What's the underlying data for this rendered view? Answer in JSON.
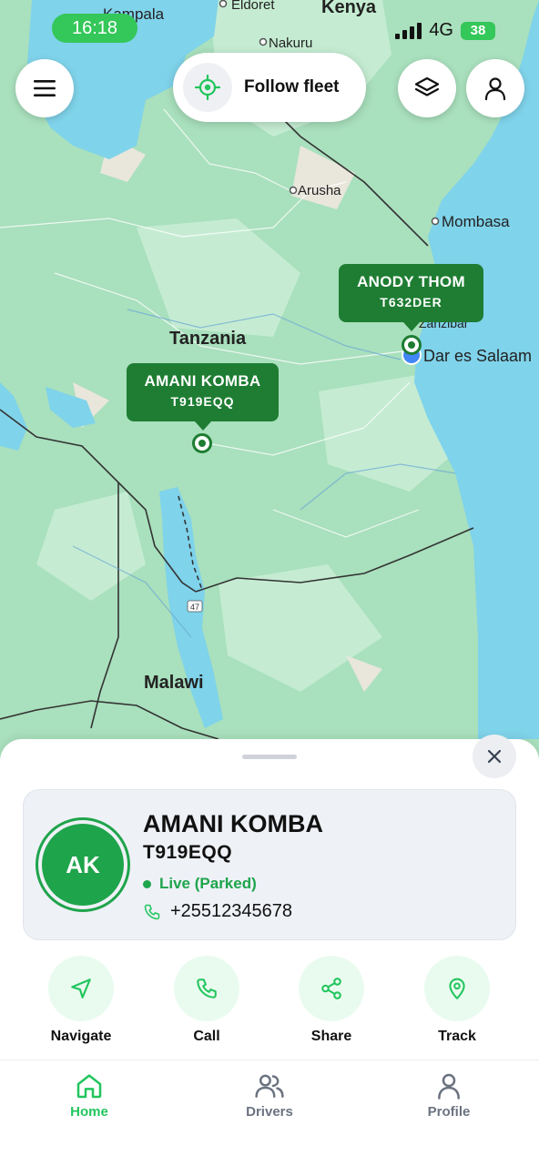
{
  "status_bar": {
    "time": "16:18",
    "network": "4G",
    "battery": "38"
  },
  "map": {
    "labels": {
      "kampala": "Kampala",
      "eldoret": "Eldoret",
      "kenya": "Kenya",
      "nakuru": "Nakuru",
      "arusha": "Arusha",
      "mombasa": "Mombasa",
      "zanzibar": "Zanzibar",
      "dar_es_salaam": "Dar es Salaam",
      "tanzania": "Tanzania",
      "malawi": "Malawi",
      "route": "47"
    },
    "markers": [
      {
        "name": "ANODY THOM",
        "plate": "T632DER"
      },
      {
        "name": "AMANI KOMBA",
        "plate": "T919EQQ"
      }
    ]
  },
  "toolbar": {
    "follow_label": "Follow fleet"
  },
  "driver": {
    "initials": "AK",
    "name": "AMANI KOMBA",
    "plate": "T919EQQ",
    "status": "Live (Parked)",
    "phone": "+25512345678"
  },
  "actions": [
    {
      "label": "Navigate",
      "icon": "navigate-arrow-icon"
    },
    {
      "label": "Call",
      "icon": "phone-icon"
    },
    {
      "label": "Share",
      "icon": "share-icon"
    },
    {
      "label": "Track",
      "icon": "location-pin-icon"
    }
  ],
  "tabs": [
    {
      "label": "Home",
      "icon": "home-icon",
      "active": true
    },
    {
      "label": "Drivers",
      "icon": "users-icon",
      "active": false
    },
    {
      "label": "Profile",
      "icon": "user-icon",
      "active": false
    }
  ],
  "colors": {
    "accent": "#22c55e",
    "marker": "#1e7d32",
    "land": "#aee3c1",
    "water": "#7fd3ea",
    "status_green": "#34c759"
  }
}
